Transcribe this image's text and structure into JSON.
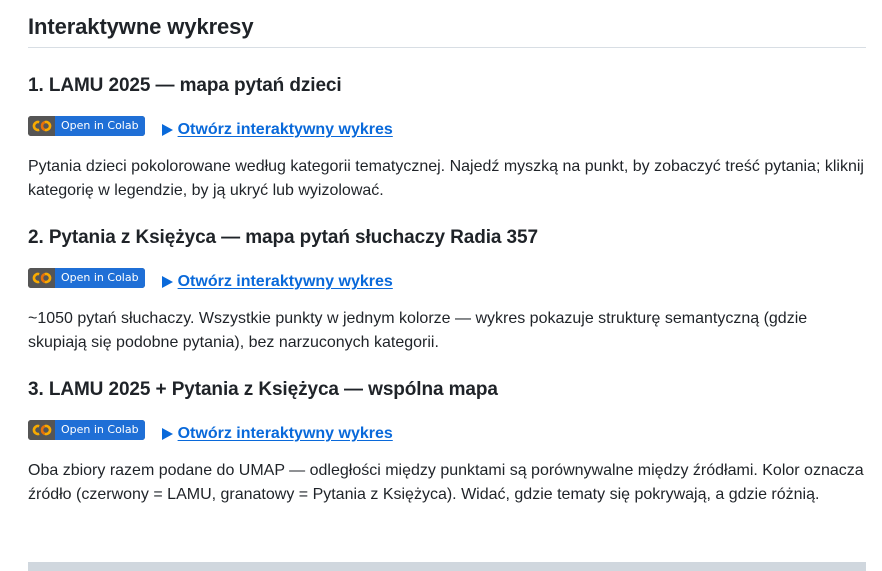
{
  "page": {
    "title": "Interaktywne wykresy"
  },
  "sections": [
    {
      "heading": "1. LAMU 2025 — mapa pytań dzieci",
      "badge_label": "Open in Colab",
      "link_label": "Otwórz interaktywny wykres",
      "description": "Pytania dzieci pokolorowane według kategorii tematycznej. Najedź myszką na punkt, by zobaczyć treść pytania; kliknij kategorię w legendzie, by ją ukryć lub wyizolować."
    },
    {
      "heading": "2. Pytania z Księżyca — mapa pytań słuchaczy Radia 357",
      "badge_label": "Open in Colab",
      "link_label": "Otwórz interaktywny wykres",
      "description": "~1050 pytań słuchaczy. Wszystkie punkty w jednym kolorze — wykres pokazuje strukturę semantyczną (gdzie skupiają się podobne pytania), bez narzuconych kategorii."
    },
    {
      "heading": "3. LAMU 2025 + Pytania z Księżyca — wspólna mapa",
      "badge_label": "Open in Colab",
      "link_label": "Otwórz interaktywny wykres",
      "description": "Oba zbiory razem podane do UMAP — odległości między punktami są porównywalne między źródłami. Kolor oznacza źródło (czerwony = LAMU, granatowy = Pytania z Księżyca). Widać, gdzie tematy się pokrywają, a gdzie różnią."
    }
  ],
  "icons": {
    "colab": "colab-logo-icon",
    "link": "play-triangle-icon"
  },
  "colors": {
    "link": "#0969da",
    "badge_right": "#1f6fd6",
    "badge_left": "#555555",
    "colab_orange": "#f9ab00",
    "colab_yellow": "#f9ab00"
  }
}
